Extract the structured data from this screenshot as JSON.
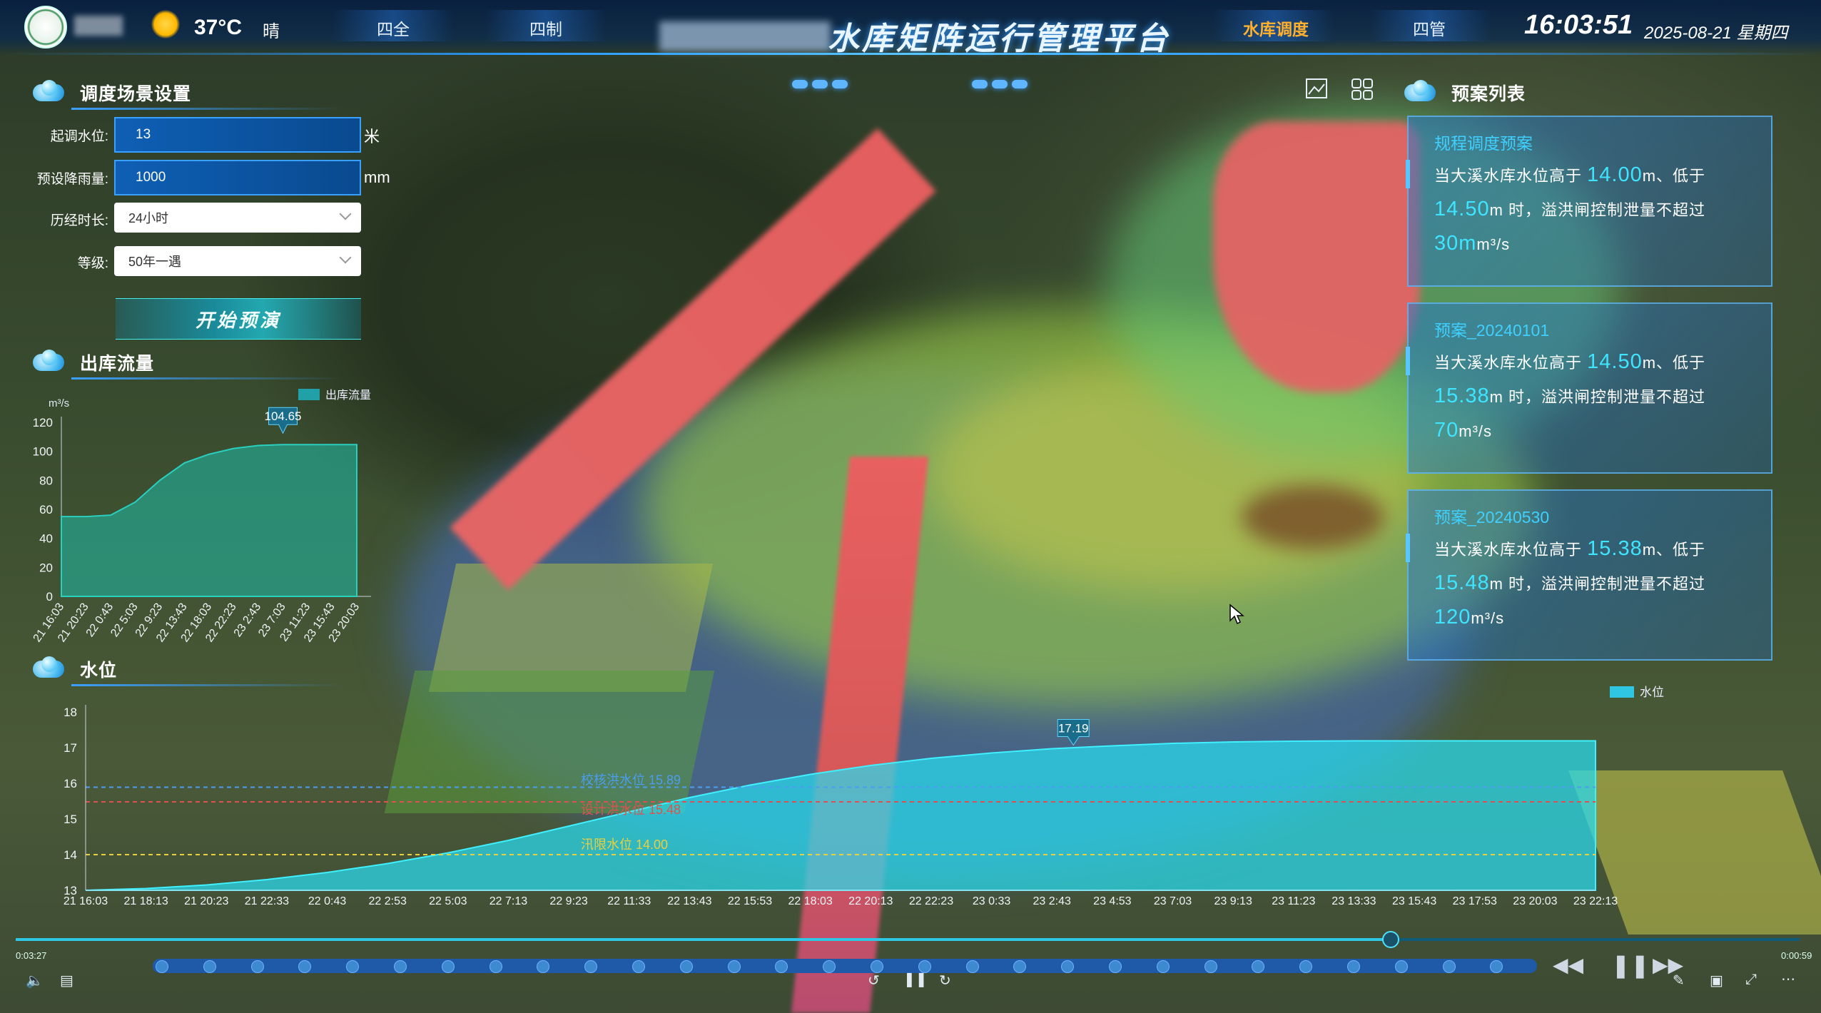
{
  "header": {
    "temperature": "37°C",
    "weather": "晴",
    "title": "水库矩阵运行管理平台",
    "nav": [
      {
        "label": "四全",
        "active": false
      },
      {
        "label": "四制",
        "active": false
      },
      {
        "label": "水库调度",
        "active": true
      },
      {
        "label": "四管",
        "active": false
      }
    ],
    "time": "16:03:51",
    "date": "2025-08-21 星期四"
  },
  "scenario": {
    "title": "调度场景设置",
    "fields": {
      "start_level_label": "起调水位:",
      "start_level_value": "13",
      "start_level_unit": "米",
      "rainfall_label": "预设降雨量:",
      "rainfall_value": "1000",
      "rainfall_unit": "mm",
      "duration_label": "历经时长:",
      "duration_value": "24小时",
      "grade_label": "等级:",
      "grade_value": "50年一遇"
    },
    "start_button": "开始预演"
  },
  "outflow": {
    "title": "出库流量",
    "legend": "出库流量",
    "unit": "m³/s",
    "peak_label": "104.65"
  },
  "waterlevel": {
    "title": "水位",
    "legend": "水位",
    "peak_label": "17.19",
    "refs": [
      {
        "label": "校核洪水位 15.89",
        "value": 15.89,
        "color": "#4a9df0"
      },
      {
        "label": "设计洪水位 15.48",
        "value": 15.48,
        "color": "#e05050"
      },
      {
        "label": "汛限水位 14.00",
        "value": 14.0,
        "color": "#e8d040"
      }
    ]
  },
  "plans": {
    "title": "预案列表",
    "items": [
      {
        "name": "规程调度预案",
        "pre": "当大溪水库水位高于",
        "low": "14.00",
        "mid": "m、低于",
        "high": "14.50",
        "post": "m 时，溢洪闸控制泄量不超过",
        "flow": "30m",
        "unit": "m³/s"
      },
      {
        "name": "预案_20240101",
        "pre": "当大溪水库水位高于",
        "low": "14.50",
        "mid": "m、低于",
        "high": "15.38",
        "post": "m 时，溢洪闸控制泄量不超过",
        "flow": "70",
        "unit": "m³/s"
      },
      {
        "name": "预案_20240530",
        "pre": "当大溪水库水位高于",
        "low": "15.38",
        "mid": "m、低于",
        "high": "15.48",
        "post": "m 时，溢洪闸控制泄量不超过",
        "flow": "120",
        "unit": "m³/s"
      }
    ]
  },
  "player": {
    "elapsed": "0:03:27",
    "remaining": "0:00:59",
    "progress": 0.77
  },
  "chart_data": [
    {
      "type": "area",
      "title": "出库流量",
      "ylabel": "m³/s",
      "ylim": [
        0,
        120
      ],
      "yticks": [
        0,
        20,
        40,
        60,
        80,
        100,
        120
      ],
      "categories": [
        "21 16:03",
        "21 20:23",
        "22 0:43",
        "22 5:03",
        "22 9:23",
        "22 13:43",
        "22 18:03",
        "22 22:23",
        "23 2:43",
        "23 7:03",
        "23 11:23",
        "23 15:43",
        "23 20:03"
      ],
      "series": [
        {
          "name": "出库流量",
          "values": [
            55,
            55,
            56,
            65,
            80,
            92,
            98,
            102,
            104,
            104.65,
            104.65,
            104.65,
            104.65
          ]
        }
      ],
      "annotations": [
        {
          "label": "104.65",
          "value": 104.65
        }
      ]
    },
    {
      "type": "area",
      "title": "水位",
      "ylim": [
        13,
        18
      ],
      "yticks": [
        13,
        14,
        15,
        16,
        17,
        18
      ],
      "categories": [
        "21 16:03",
        "21 18:13",
        "21 20:23",
        "21 22:33",
        "22 0:43",
        "22 2:53",
        "22 5:03",
        "22 7:13",
        "22 9:23",
        "22 11:33",
        "22 13:43",
        "22 15:53",
        "22 18:03",
        "22 20:13",
        "22 22:23",
        "23 0:33",
        "23 2:43",
        "23 4:53",
        "23 7:03",
        "23 9:13",
        "23 11:23",
        "23 13:33",
        "23 15:43",
        "23 17:53",
        "23 20:03",
        "23 22:13"
      ],
      "series": [
        {
          "name": "水位",
          "values": [
            13.0,
            13.05,
            13.15,
            13.3,
            13.5,
            13.75,
            14.05,
            14.4,
            14.8,
            15.2,
            15.6,
            15.95,
            16.25,
            16.5,
            16.7,
            16.85,
            16.97,
            17.05,
            17.12,
            17.16,
            17.18,
            17.19,
            17.19,
            17.19,
            17.19,
            17.19
          ]
        }
      ],
      "reference_lines": [
        {
          "label": "校核洪水位 15.89",
          "value": 15.89
        },
        {
          "label": "设计洪水位 15.48",
          "value": 15.48
        },
        {
          "label": "汛限水位 14.00",
          "value": 14.0
        }
      ],
      "annotations": [
        {
          "label": "17.19",
          "value": 17.19
        }
      ]
    }
  ]
}
